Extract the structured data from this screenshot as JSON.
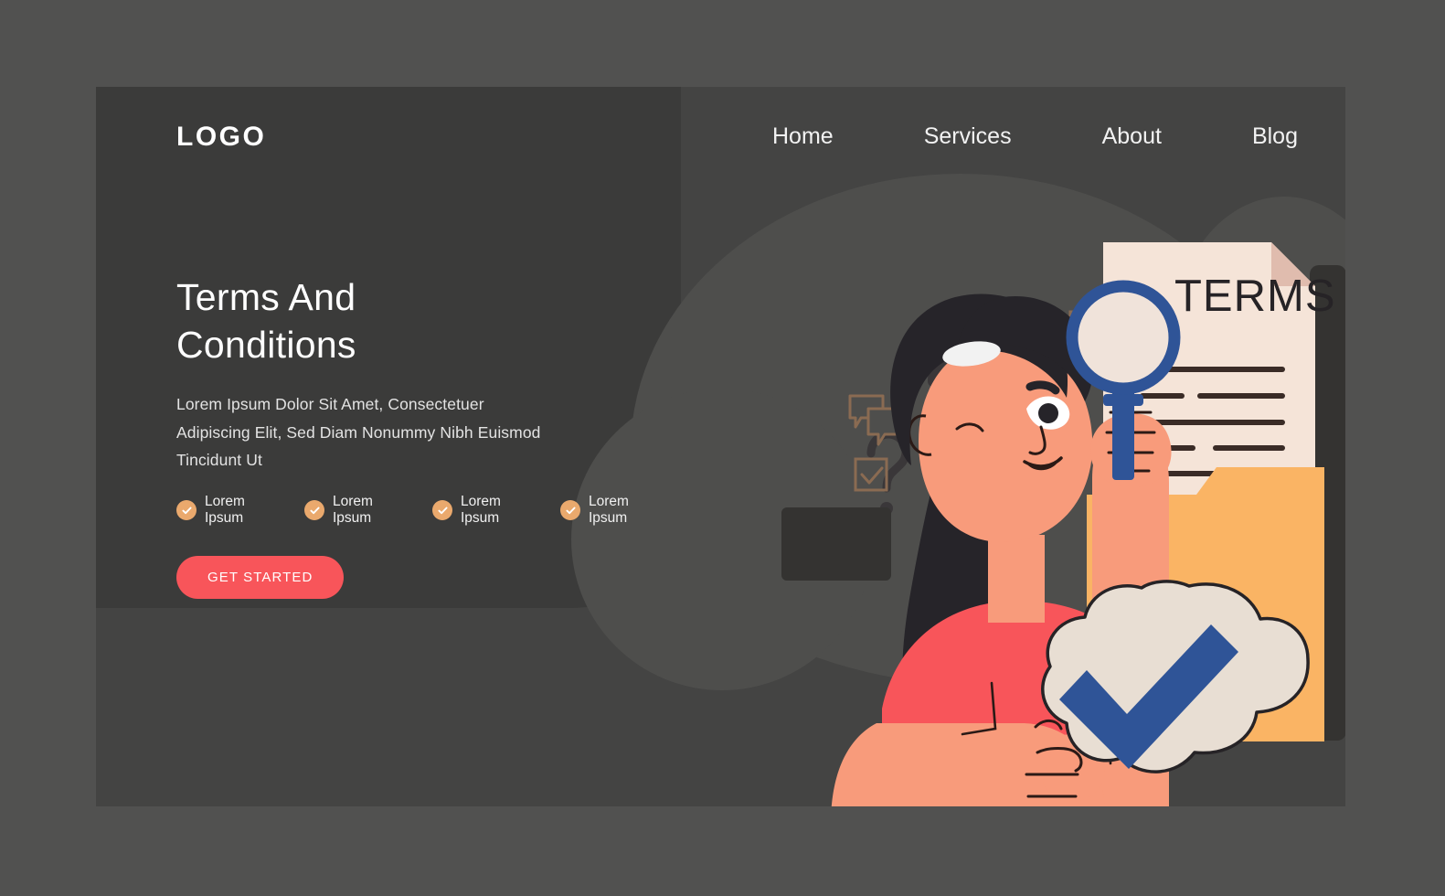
{
  "page": {
    "background_color": "#515150",
    "card_color": "#444443",
    "panel_color": "#3b3b3a"
  },
  "header": {
    "logo": "LOGO",
    "nav": [
      {
        "label": "Home"
      },
      {
        "label": "Services"
      },
      {
        "label": "About"
      },
      {
        "label": "Blog"
      }
    ]
  },
  "hero": {
    "title_line1": "Terms And",
    "title_line2": "Conditions",
    "subtitle": "Lorem Ipsum Dolor Sit Amet, Consectetuer Adipiscing Elit, Sed Diam Nonummy Nibh Euismod Tincidunt Ut",
    "features": [
      {
        "label": "Lorem Ipsum",
        "icon": "check-circle-icon"
      },
      {
        "label": "Lorem Ipsum",
        "icon": "check-circle-icon"
      },
      {
        "label": "Lorem Ipsum",
        "icon": "check-circle-icon"
      },
      {
        "label": "Lorem Ipsum",
        "icon": "check-circle-icon"
      }
    ],
    "cta_label": "GET STARTED"
  },
  "illustration": {
    "document_title": "TERMS",
    "icons": [
      "question-mark-icon",
      "question-mark-icon",
      "question-mark-icon",
      "checkbox-icon",
      "checkbox-icon",
      "chat-bubbles-icon",
      "magnifying-glass-icon",
      "folder-icon",
      "thought-bubble-check-icon",
      "person-illustration"
    ]
  },
  "colors": {
    "accent_red": "#f8555a",
    "accent_orange": "#eaa96d",
    "folder_orange": "#fab464",
    "paper_cream": "#f5e4d8",
    "blue": "#2f5497",
    "skin": "#f89b7b",
    "hair": "#262429",
    "outline_tan": "#8a6b52"
  }
}
